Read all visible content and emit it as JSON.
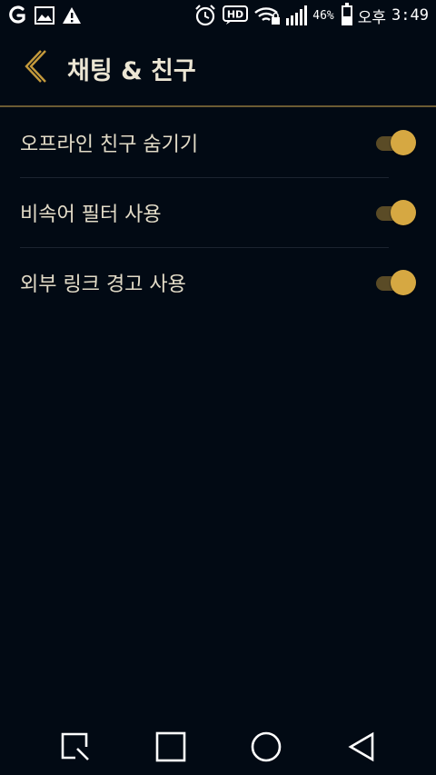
{
  "status_bar": {
    "left_icons": [
      "carrier-logo-icon",
      "gallery-icon",
      "warning-icon"
    ],
    "right_icons": [
      "alarm-icon",
      "hd-voice-icon",
      "wifi-icon",
      "signal-icon",
      "battery-icon"
    ],
    "hd_label": "HD",
    "battery_percent": "46%",
    "ampm": "오후",
    "time": "3:49",
    "battery_level": 0.46
  },
  "header": {
    "back_icon": "chevron-left-icon",
    "title": "채팅 & 친구"
  },
  "settings": [
    {
      "label": "오프라인 친구 숨기기",
      "enabled": true
    },
    {
      "label": "비속어 필터 사용",
      "enabled": true
    },
    {
      "label": "외부 링크 경고 사용",
      "enabled": true
    }
  ],
  "nav_bar": {
    "buttons": [
      "quick-memo-icon",
      "recent-apps-icon",
      "home-icon",
      "back-icon"
    ]
  },
  "colors": {
    "background": "#020a14",
    "accent": "#d6a842",
    "toggle_track": "#5a4b26",
    "divider": "#6b5b33",
    "text": "#e3dcc8"
  }
}
